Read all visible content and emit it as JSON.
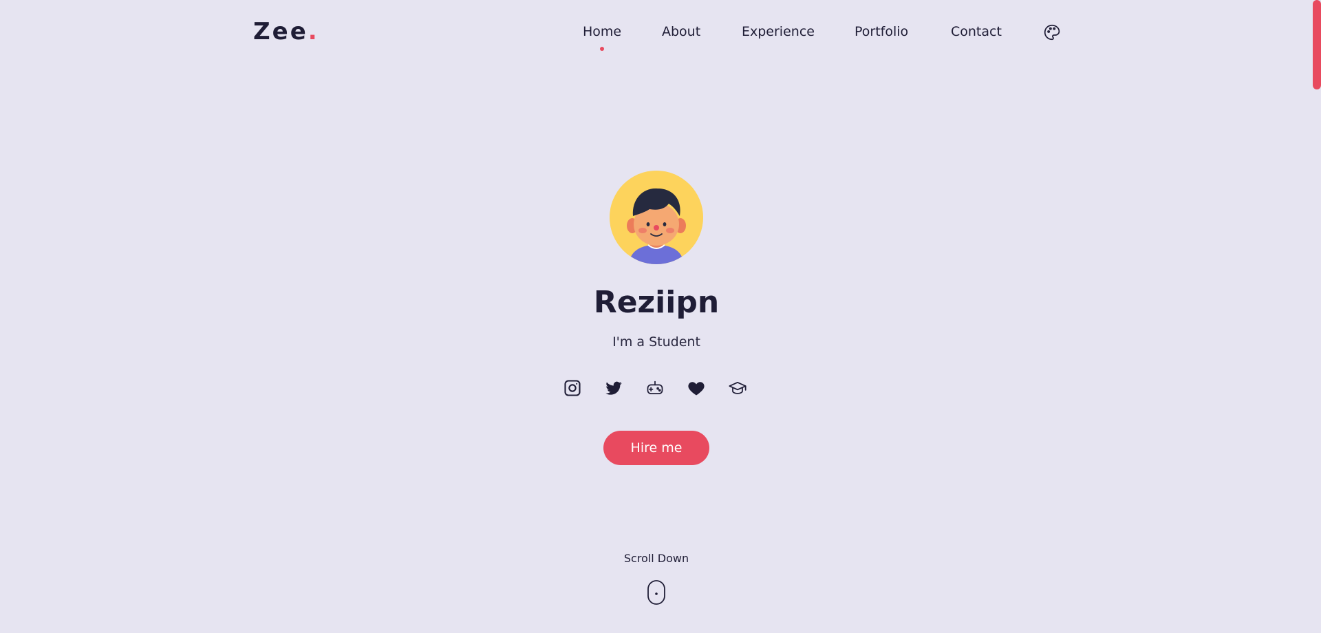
{
  "header": {
    "logo_text": "Zee",
    "logo_dot": ".",
    "nav": [
      {
        "label": "Home",
        "active": true
      },
      {
        "label": "About",
        "active": false
      },
      {
        "label": "Experience",
        "active": false
      },
      {
        "label": "Portfolio",
        "active": false
      },
      {
        "label": "Contact",
        "active": false
      }
    ],
    "theme_icon": "palette-icon"
  },
  "hero": {
    "name": "Reziipn",
    "role": "I'm a Student",
    "socials": [
      {
        "icon": "instagram-icon"
      },
      {
        "icon": "twitter-icon"
      },
      {
        "icon": "gamepad-icon"
      },
      {
        "icon": "heart-icon"
      },
      {
        "icon": "graduation-cap-icon"
      }
    ],
    "hire_label": "Hire me",
    "scroll_label": "Scroll Down",
    "scroll_icon": "mouse-icon"
  },
  "colors": {
    "background": "#e6e4f1",
    "accent": "#e84a5f",
    "text": "#1f1d36",
    "avatar_bg": "#fdd35c"
  }
}
